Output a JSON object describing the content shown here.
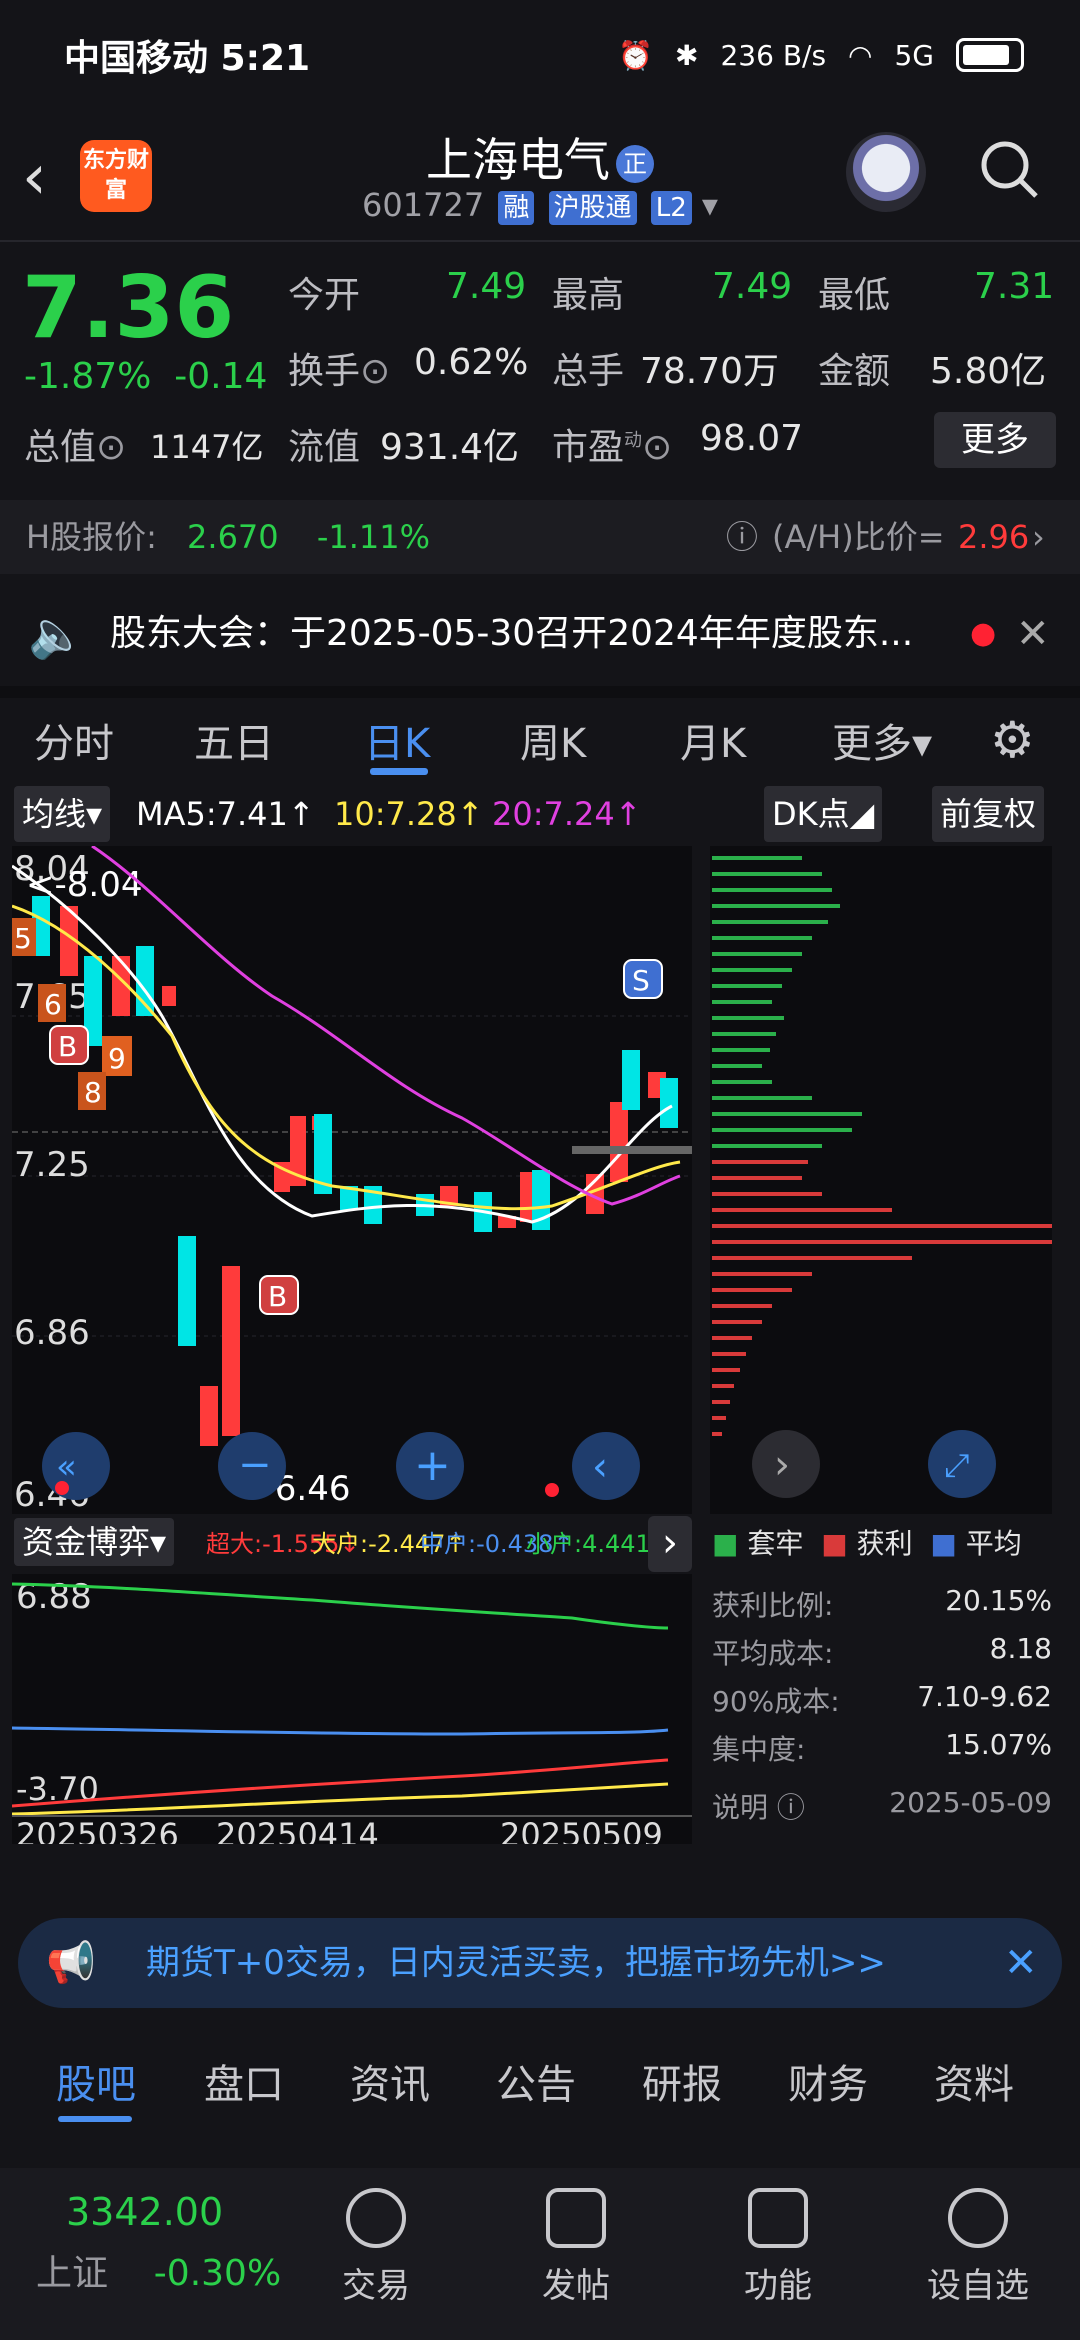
{
  "status": {
    "carrier_time": "中国移动 5:21",
    "net_speed": "236 B/s",
    "network": "5G"
  },
  "header": {
    "logo_text": "东方财富",
    "title": "上海电气",
    "badge": "正",
    "code": "601727",
    "tags": [
      "融",
      "沪股通",
      "L2"
    ]
  },
  "quote": {
    "price": "7.36",
    "change_pct": "-1.87%",
    "change": "-0.14",
    "fields": [
      {
        "label": "今开",
        "value": "7.49"
      },
      {
        "label": "最高",
        "value": "7.49"
      },
      {
        "label": "最低",
        "value": "7.31"
      },
      {
        "label": "换手",
        "value": "0.62%"
      },
      {
        "label": "总手",
        "value": "78.70万"
      },
      {
        "label": "金额",
        "value": "5.80亿"
      },
      {
        "label": "总值",
        "value": "1147亿"
      },
      {
        "label": "流值",
        "value": "931.4亿"
      },
      {
        "label": "市盈",
        "value": "98.07"
      }
    ],
    "pe_mark": "动",
    "more_label": "更多"
  },
  "hshare": {
    "label": "H股报价:",
    "price": "2.670",
    "change": "-1.11%",
    "ratio_label": "(A/H)比价=",
    "ratio": "2.96"
  },
  "notice": {
    "text": "股东大会：于2025-05-30召开2024年年度股东..."
  },
  "tabs": [
    "分时",
    "五日",
    "日K",
    "周K",
    "月K",
    "更多"
  ],
  "chart_bar": {
    "ma_select": "均线",
    "ma5": "MA5:7.41↑",
    "ma10": "10:7.28↑",
    "ma20": "20:7.24↑",
    "dk": "DK点",
    "fq": "前复权"
  },
  "kline": {
    "y_labels": [
      "8.04",
      "7.65",
      "7.25",
      "6.86",
      "6.46"
    ],
    "high_label": "<-8.04",
    "low_label": "<-6.46",
    "markers": [
      "5",
      "6",
      "B",
      "9",
      "8",
      "B",
      "S"
    ]
  },
  "fund": {
    "select": "资金博弈",
    "super": "超大:-1.555↓",
    "big": "大户:-2.447↑",
    "mid": "中户:-0.438↑",
    "small": "小户:4.441↑",
    "y_top": "6.88",
    "y_bottom": "-3.70",
    "dates": [
      "20250326",
      "20250414",
      "20250509"
    ]
  },
  "chip": {
    "legend": [
      "套牢",
      "获利",
      "平均"
    ],
    "stats": [
      {
        "label": "获利比例:",
        "value": "20.15%"
      },
      {
        "label": "平均成本:",
        "value": "8.18"
      },
      {
        "label": "90%成本:",
        "value": "7.10-9.62"
      },
      {
        "label": "集中度:",
        "value": "15.07%"
      }
    ],
    "note": "说明",
    "date": "2025-05-09"
  },
  "promo": {
    "text": "期货T+0交易，日内灵活买卖，把握市场先机>>"
  },
  "bottom_tabs": [
    "股吧",
    "盘口",
    "资讯",
    "公告",
    "研报",
    "财务",
    "资料"
  ],
  "index": {
    "value": "3342.00",
    "name": "上证",
    "change": "-0.30%"
  },
  "nav": [
    "交易",
    "发帖",
    "功能",
    "设自选"
  ],
  "colors": {
    "up": "#ff3b3b",
    "down": "#2bd04b",
    "accent": "#4a8ff0",
    "candle_down": "#00e5e5"
  }
}
